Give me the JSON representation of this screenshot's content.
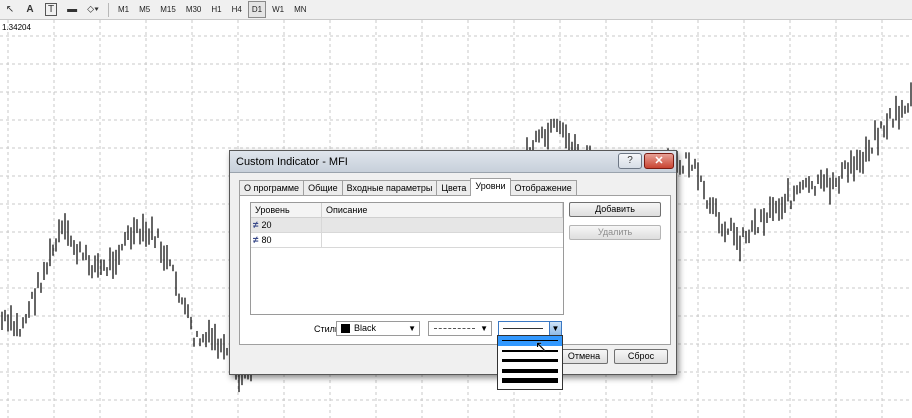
{
  "toolbar": {
    "tools": [
      {
        "name": "cursor-tool-icon",
        "glyph": "↖"
      },
      {
        "name": "text-tool-icon",
        "glyph": "A"
      },
      {
        "name": "label-tool-icon",
        "glyph": "T"
      },
      {
        "name": "rectangle-tool-icon",
        "glyph": "▬"
      },
      {
        "name": "objects-tool-icon",
        "glyph": "⬦▾"
      }
    ],
    "timeframes": [
      "M1",
      "M5",
      "M15",
      "M30",
      "H1",
      "H4",
      "D1",
      "W1",
      "MN"
    ],
    "active_timeframe": "D1"
  },
  "chart": {
    "price_label": "1.34204"
  },
  "dialog": {
    "title": "Custom Indicator - MFI",
    "help_label": "?",
    "close_label": "✕",
    "tabs": [
      "О программе",
      "Общие",
      "Входные параметры",
      "Цвета",
      "Уровни",
      "Отображение"
    ],
    "active_tab": "Уровни",
    "grid": {
      "headers": [
        "Уровень",
        "Описание"
      ],
      "rows": [
        {
          "level": "20",
          "description": "",
          "selected": true
        },
        {
          "level": "80",
          "description": "",
          "selected": false
        }
      ]
    },
    "add_button": "Добавить",
    "delete_button": "Удалить",
    "style_label": "Стиль:",
    "color_value": "Black",
    "cancel_button": "Отмена",
    "reset_button": "Сброс"
  },
  "colors": {
    "selection": "#3399ff",
    "close_button": "#c94432",
    "candles": "#000000"
  }
}
